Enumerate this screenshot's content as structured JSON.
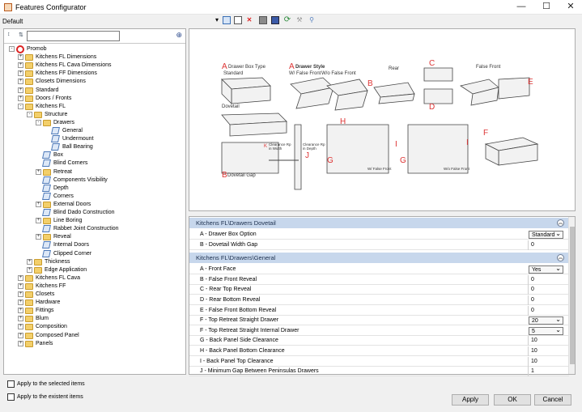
{
  "window": {
    "title": "Features Configurator",
    "minimize": "—",
    "maximize": "☐",
    "close": "✕"
  },
  "profile": "Default",
  "toolbar_icons": [
    "dropdown-arrow-icon",
    "add-icon",
    "copy-icon",
    "delete-icon",
    "save-icon",
    "grid-icon",
    "refresh-icon",
    "tools-icon",
    "wand-icon"
  ],
  "search": {
    "value": "",
    "placeholder": ""
  },
  "tree": [
    {
      "label": "Promob",
      "icon": "promob-icon",
      "exp": "-"
    },
    {
      "label": "Kitchens FL Dimensions",
      "icon": "folder-icon",
      "exp": "+"
    },
    {
      "label": "Kitchens FL Cava Dimensions",
      "icon": "folder-icon",
      "exp": "+"
    },
    {
      "label": "Kitchens FF Dimensions",
      "icon": "folder-icon",
      "exp": "+"
    },
    {
      "label": "Closets Dimensions",
      "icon": "folder-icon",
      "exp": "+"
    },
    {
      "label": "Standard",
      "icon": "folder-icon",
      "exp": "+"
    },
    {
      "label": "Doors / Fronts",
      "icon": "folder-icon",
      "exp": "+"
    },
    {
      "label": "Kitchens FL",
      "icon": "folder-icon",
      "exp": "-"
    },
    {
      "label": "Structure",
      "icon": "folder-icon",
      "exp": "-"
    },
    {
      "label": "Drawers",
      "icon": "folder-icon",
      "exp": "-"
    },
    {
      "label": "General",
      "icon": "feature-icon",
      "exp": ""
    },
    {
      "label": "Undermount",
      "icon": "feature-icon",
      "exp": ""
    },
    {
      "label": "Ball Bearing",
      "icon": "feature-icon",
      "exp": ""
    },
    {
      "label": "Box",
      "icon": "feature-icon",
      "exp": ""
    },
    {
      "label": "Blind Corners",
      "icon": "feature-icon",
      "exp": ""
    },
    {
      "label": "Retreat",
      "icon": "folder-icon",
      "exp": "+"
    },
    {
      "label": "Components Visibility",
      "icon": "feature-icon",
      "exp": ""
    },
    {
      "label": "Depth",
      "icon": "feature-icon",
      "exp": ""
    },
    {
      "label": "Corners",
      "icon": "feature-icon",
      "exp": ""
    },
    {
      "label": "External Doors",
      "icon": "folder-icon",
      "exp": "+"
    },
    {
      "label": "Blind Dado Construction",
      "icon": "feature-icon",
      "exp": ""
    },
    {
      "label": "Line Boring",
      "icon": "folder-icon",
      "exp": "+"
    },
    {
      "label": "Rabbet Joint Construction",
      "icon": "feature-icon",
      "exp": ""
    },
    {
      "label": "Reveal",
      "icon": "folder-icon",
      "exp": "+"
    },
    {
      "label": "Internal Doors",
      "icon": "feature-icon",
      "exp": ""
    },
    {
      "label": "Clipped Corner",
      "icon": "feature-icon",
      "exp": ""
    },
    {
      "label": "Thickness",
      "icon": "folder-icon",
      "exp": "+"
    },
    {
      "label": "Edge Application",
      "icon": "folder-icon",
      "exp": "+"
    },
    {
      "label": "Kitchens FL Cava",
      "icon": "folder-icon",
      "exp": "+"
    },
    {
      "label": "Kitchens FF",
      "icon": "folder-icon",
      "exp": "+"
    },
    {
      "label": "Closets",
      "icon": "folder-icon",
      "exp": "+"
    },
    {
      "label": "Hardware",
      "icon": "folder-icon",
      "exp": "+"
    },
    {
      "label": "Fittings",
      "icon": "folder-icon",
      "exp": "+"
    },
    {
      "label": "Blum",
      "icon": "folder-icon",
      "exp": "+"
    },
    {
      "label": "Composition",
      "icon": "folder-icon",
      "exp": "+"
    },
    {
      "label": "Composed Panel",
      "icon": "folder-icon",
      "exp": "+"
    },
    {
      "label": "Panels",
      "icon": "folder-icon",
      "exp": "+"
    }
  ],
  "checkboxes": {
    "apply_selected": "Apply to the selected items",
    "apply_existent": "Apply to the existent items"
  },
  "diagram": {
    "a1": "A",
    "drawer_box_type": "Drawer Box Type",
    "standard": "Standard",
    "a2": "A",
    "drawer_style": "Drawer Style",
    "wfalse": "W/ False Front",
    "wofalse": "W/o False Front",
    "b1": "B",
    "rear": "Rear",
    "c": "C",
    "d": "D",
    "false_front": "False Front",
    "e": "E",
    "dovetail": "Dovetail",
    "b2": "B",
    "dovetail_gap": "Dovetail Gap",
    "k": "K",
    "clear_width": "Clearance Rp in Width",
    "clear_depth": "Clearance Rp in Depth",
    "j": "J",
    "h": "H",
    "g1": "G",
    "wfalse2": "W/ False Front",
    "i1": "I",
    "g2": "G",
    "wofalse2": "W/o False Front",
    "i2": "I",
    "f": "F"
  },
  "groups": [
    {
      "title": "Kitchens FL\\Drawers Dovetail",
      "collapse": "︽",
      "rows": [
        {
          "name": "A - Drawer Box Option",
          "value": "Standard",
          "select": true
        },
        {
          "name": "B - Dovetail Width Gap",
          "value": "0",
          "select": false
        }
      ]
    },
    {
      "title": "Kitchens FL\\Drawers\\General",
      "collapse": "︽",
      "rows": [
        {
          "name": "A - Front Face",
          "value": "Yes",
          "select": true
        },
        {
          "name": "B - False Front Reveal",
          "value": "0",
          "select": false
        },
        {
          "name": "C - Rear Top Reveal",
          "value": "0",
          "select": false
        },
        {
          "name": "D - Rear Bottom Reveal",
          "value": "0",
          "select": false
        },
        {
          "name": "E - False Front Bottom Reveal",
          "value": "0",
          "select": false
        },
        {
          "name": "F - Top Retreat Straight Drawer",
          "value": "20",
          "select": true
        },
        {
          "name": "F - Top Retreat Straight Internal Drawer",
          "value": "5",
          "select": true
        },
        {
          "name": "G - Back Panel Side Clearance",
          "value": "10",
          "select": false
        },
        {
          "name": "H - Back Panel Bottom Clearance",
          "value": "10",
          "select": false
        },
        {
          "name": "I - Back Panel Top Clearance",
          "value": "10",
          "select": false
        },
        {
          "name": "J - Minimum Gap Between Peninsulas Drawers",
          "value": "1",
          "select": false
        }
      ]
    }
  ],
  "buttons": {
    "apply": "Apply",
    "ok": "OK",
    "cancel": "Cancel"
  }
}
